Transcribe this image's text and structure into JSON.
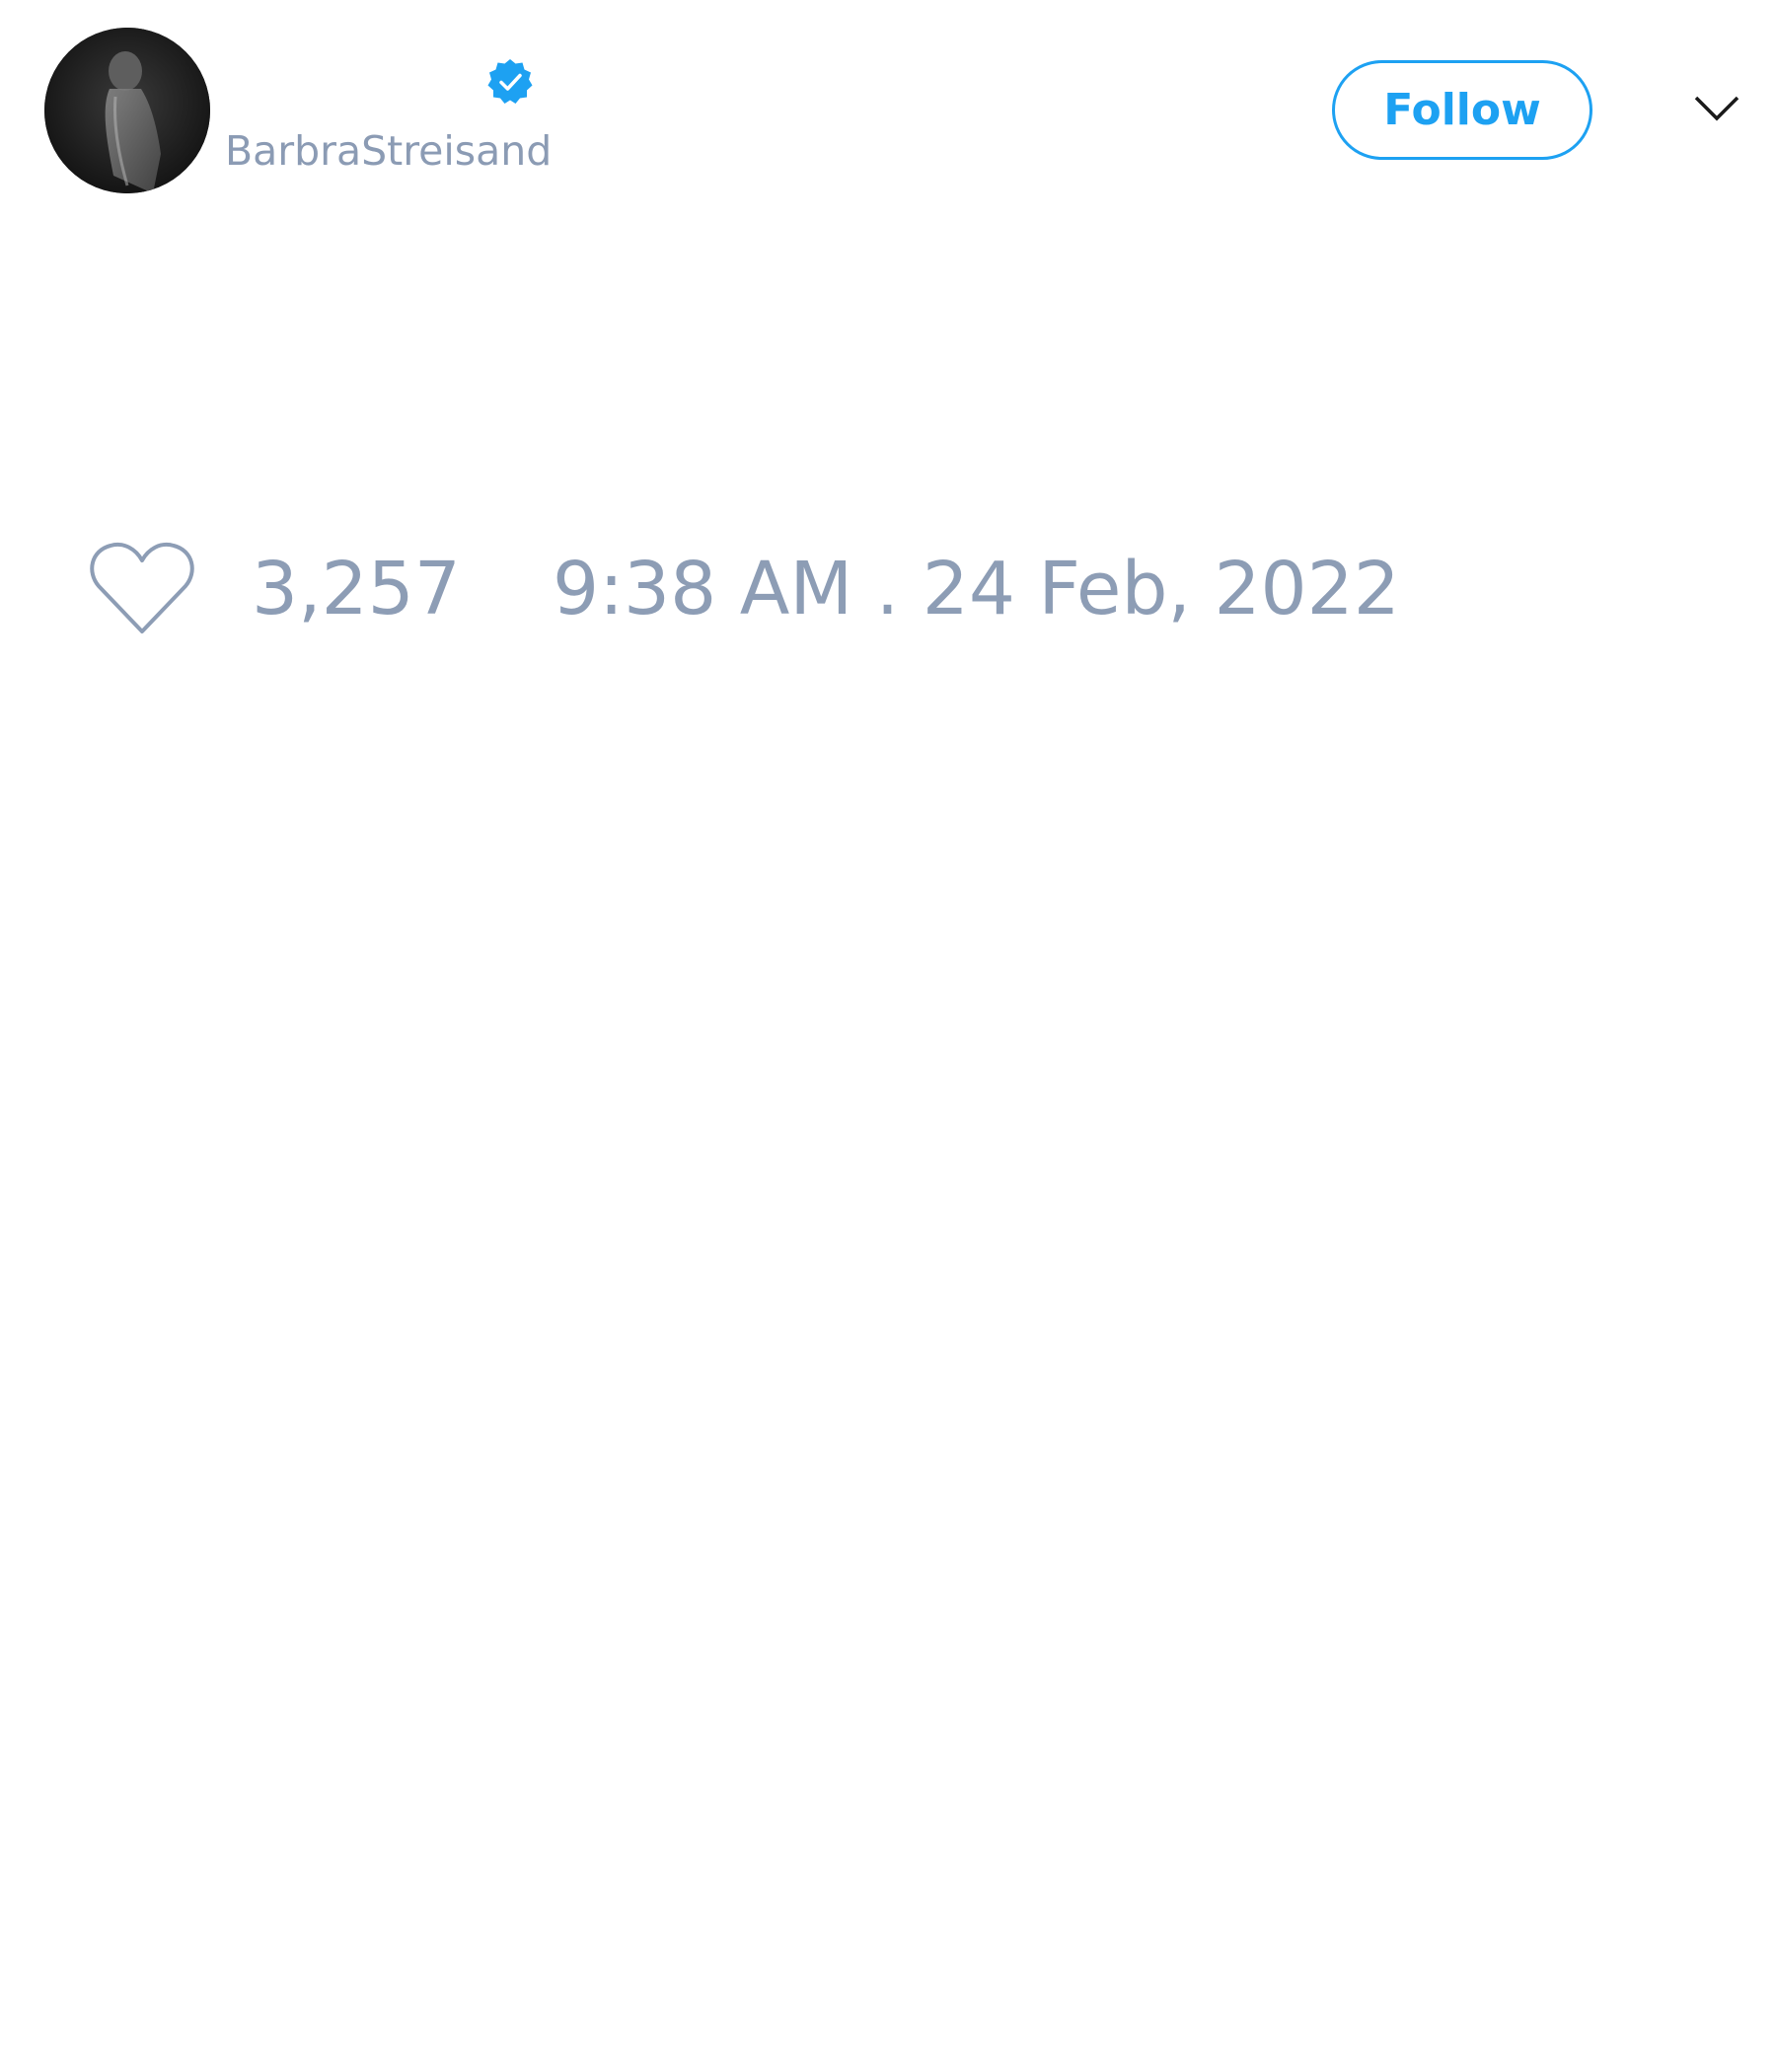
{
  "header": {
    "author_handle": "BarbraStreisand",
    "verified": true,
    "avatar_icon": "avatar-photo",
    "verified_icon": "verified-badge-icon",
    "follow_label": "Follow",
    "menu_icon": "chevron-down-icon"
  },
  "footer": {
    "like_icon": "heart-icon",
    "like_count": "3,257",
    "timestamp": "9:38 AM . 24 Feb, 2022"
  },
  "colors": {
    "accent": "#1da1f2",
    "muted_text": "#8d9db5",
    "background": "#ffffff"
  }
}
